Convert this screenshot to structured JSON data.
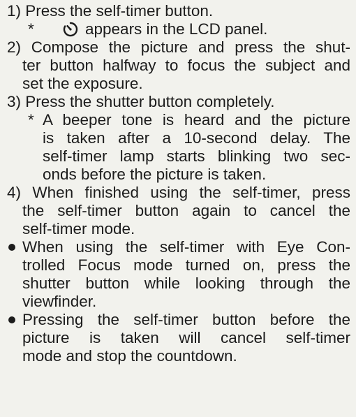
{
  "steps": {
    "s1": {
      "line1": "1) Press the self-timer button.",
      "note_star": "*",
      "note_icon": "self-timer-icon",
      "note_text": "appears in the LCD panel."
    },
    "s2": {
      "line1": "2) Compose the picture and press the shut-",
      "line2": "ter button halfway to focus the subject and",
      "line3": "set the exposure."
    },
    "s3": {
      "line1": "3) Press the shutter button completely.",
      "note_star": "*",
      "note_line1": "A beeper tone is heard and the picture",
      "note_line2": "is taken after a 10-second delay. The",
      "note_line3": "self-timer lamp starts blinking two sec-",
      "note_line4": "onds before the picture is taken."
    },
    "s4": {
      "line1": "4) When finished using the self-timer, press",
      "line2": "the self-timer button again to cancel the",
      "line3": "self-timer mode."
    }
  },
  "bullets": {
    "b1": {
      "line1": "When using the self-timer with Eye Con-",
      "line2": "trolled Focus mode turned on, press the",
      "line3": "shutter button while looking through the",
      "line4": "viewfinder."
    },
    "b2": {
      "line1": "Pressing the self-timer button before the",
      "line2": "picture is taken will cancel self-timer",
      "line3": "mode and stop the countdown."
    }
  }
}
